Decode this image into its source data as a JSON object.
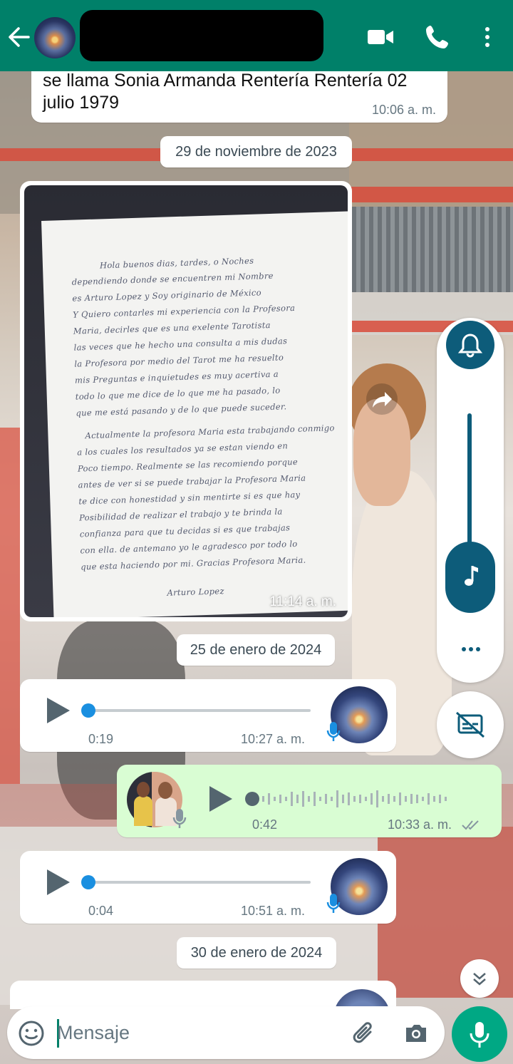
{
  "header": {
    "back_icon": "arrow-left-icon",
    "contact_name": "",
    "icons": [
      "video-call-icon",
      "phone-icon",
      "more-vertical-icon"
    ],
    "color": "#008069"
  },
  "messages": {
    "text_top": {
      "text": "se llama Sonia Armanda Rentería Rentería 02 julio 1979",
      "time": "10:06 a. m."
    },
    "date_1": "29 de noviembre de 2023",
    "image_msg": {
      "time": "11:14 a. m.",
      "letter_lines": [
        "Hola buenos dias, tardes, o Noches",
        "dependiendo donde se encuentren mi Nombre",
        "es Arturo Lopez y Soy originario de México",
        "Y Quiero contarles mi experiencia con la Profesora",
        "Maria, decirles que es una exelente Tarotista",
        "las veces que he hecho una consulta a mis dudas",
        "la Profesora por medio del Tarot me ha resuelto",
        "mis Preguntas e inquietudes es muy acertiva a",
        "todo lo que me dice de lo que me ha pasado, lo",
        "que me está pasando y de lo que puede suceder.",
        "Actualmente la profesora Maria esta trabajando conmigo",
        "a los cuales los resultados ya se estan viendo en",
        "Poco tiempo. Realmente se las recomiendo porque",
        "antes de ver si se puede trabajar la Profesora Maria",
        "te dice con honestidad y sin mentirte si es que hay",
        "Posibilidad de realizar el trabajo y te brinda la",
        "confianza para que tu decidas si es que trabajas",
        "con ella. de antemano yo le agradesco por todo lo",
        "que esta haciendo por mi. Gracias Profesora Maria.",
        "Arturo Lopez"
      ]
    },
    "date_2": "25 de enero de 2024",
    "audio_1": {
      "duration": "0:19",
      "time": "10:27 a. m.",
      "progress": 0
    },
    "audio_2": {
      "duration": "0:42",
      "time": "10:33 a. m.",
      "status_icon": "double-check-icon",
      "progress": 0
    },
    "audio_3": {
      "duration": "0:04",
      "time": "10:51 a. m.",
      "progress": 0
    },
    "date_3": "30 de enero de 2024"
  },
  "side_panel": {
    "icons": [
      "bell-icon",
      "music-note-icon",
      "more-horizontal-icon",
      "captions-off-icon"
    ],
    "volume_level": 0.6,
    "accent": "#0d5c7a"
  },
  "composer": {
    "placeholder": "Mensaje",
    "icons": [
      "emoji-icon",
      "attach-icon",
      "camera-icon",
      "mic-icon"
    ],
    "mic_color": "#00a884"
  }
}
